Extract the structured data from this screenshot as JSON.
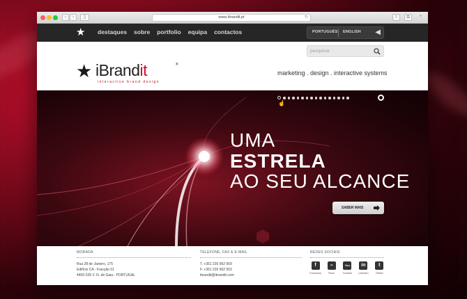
{
  "browser": {
    "url": "www.ibrandit.pt"
  },
  "nav": {
    "links": [
      "destaques",
      "sobre",
      "portfolio",
      "equipa",
      "contactos"
    ],
    "languages": [
      "PORTUGUÊS",
      "ENGLISH"
    ]
  },
  "header": {
    "search_placeholder": "pesquisar",
    "logo_main": "iBrand",
    "logo_accent": "it",
    "logo_registered": "®",
    "logo_subtitle": "interactive brand design",
    "tagline": "marketing . design . interactive systems"
  },
  "hero": {
    "line1": "UMA",
    "line2": "ESTRELA",
    "line3": "AO SEU ALCANCE",
    "cta_label": "SABER MAIS",
    "slide_active": 1,
    "slide_count": 16
  },
  "footer": {
    "address": {
      "heading": "MORADA",
      "lines": [
        "Rua 28 de Janeiro, 175",
        "Edifício CA - Fracção 01",
        "4400-335 V. N. de Gaia - PORTUGAL"
      ]
    },
    "contact": {
      "heading": "TELEFONE, FAX E E-MAIL",
      "lines": [
        "T. +351 220 962 569",
        "F. +351 220 962 563",
        "ibrandit@ibrandit.com"
      ]
    },
    "social": {
      "heading": "REDES SOCIAIS",
      "items": [
        {
          "label": "Facebook",
          "glyph": "f"
        },
        {
          "label": "Flickr",
          "glyph": "••"
        },
        {
          "label": "Youtube",
          "glyph": "You"
        },
        {
          "label": "LinkedIn",
          "glyph": "in"
        },
        {
          "label": "Twitter",
          "glyph": "t"
        }
      ]
    }
  },
  "colors": {
    "brand_red": "#c8102e",
    "nav_bg": "#262626",
    "hero_dark": "#1c0307"
  }
}
